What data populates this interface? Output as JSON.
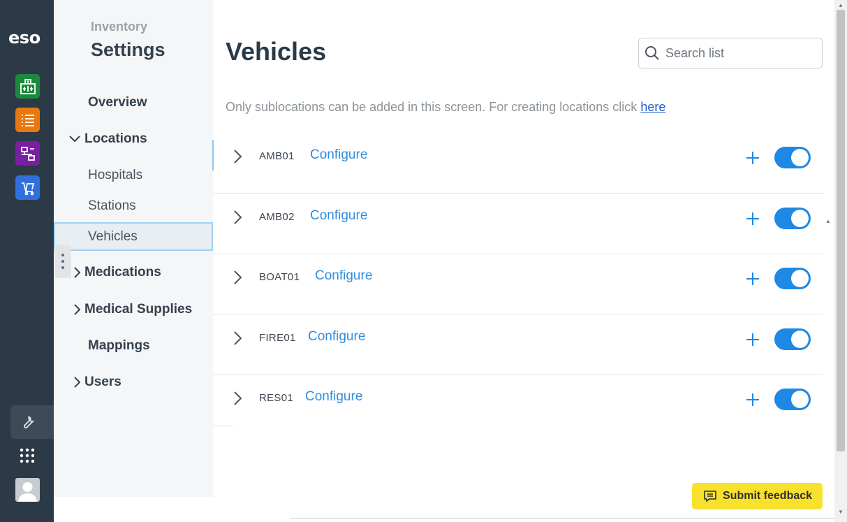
{
  "rail": {
    "logo": "eso",
    "apps": [
      {
        "name": "hospital-app-icon",
        "color": "#1b8a3e"
      },
      {
        "name": "list-app-icon",
        "color": "#e8790f"
      },
      {
        "name": "workflow-app-icon",
        "color": "#7a1fa2"
      },
      {
        "name": "inventory-cart-app-icon",
        "color": "#2f6fde"
      }
    ]
  },
  "subnav": {
    "eyebrow": "Inventory",
    "title": "Settings",
    "items": [
      {
        "label": "Overview"
      },
      {
        "label": "Locations"
      },
      {
        "label": "Hospitals"
      },
      {
        "label": "Stations"
      },
      {
        "label": "Vehicles"
      },
      {
        "label": "Medications"
      },
      {
        "label": "Medical Supplies"
      },
      {
        "label": "Mappings"
      },
      {
        "label": "Users"
      }
    ]
  },
  "main": {
    "title": "Vehicles",
    "search_placeholder": "Search list",
    "info_text": "Only sublocations can be added in this screen. For creating locations click ",
    "info_link": "here",
    "configure_label": "Configure",
    "rows": [
      {
        "name": "AMB01",
        "enabled": true
      },
      {
        "name": "AMB02",
        "enabled": true
      },
      {
        "name": "BOAT01",
        "enabled": true
      },
      {
        "name": "FIRE01",
        "enabled": true
      },
      {
        "name": "RES01",
        "enabled": true
      }
    ]
  },
  "feedback": {
    "label": "Submit feedback",
    "color": "#f7e12c"
  },
  "accent": "#1e88e5"
}
